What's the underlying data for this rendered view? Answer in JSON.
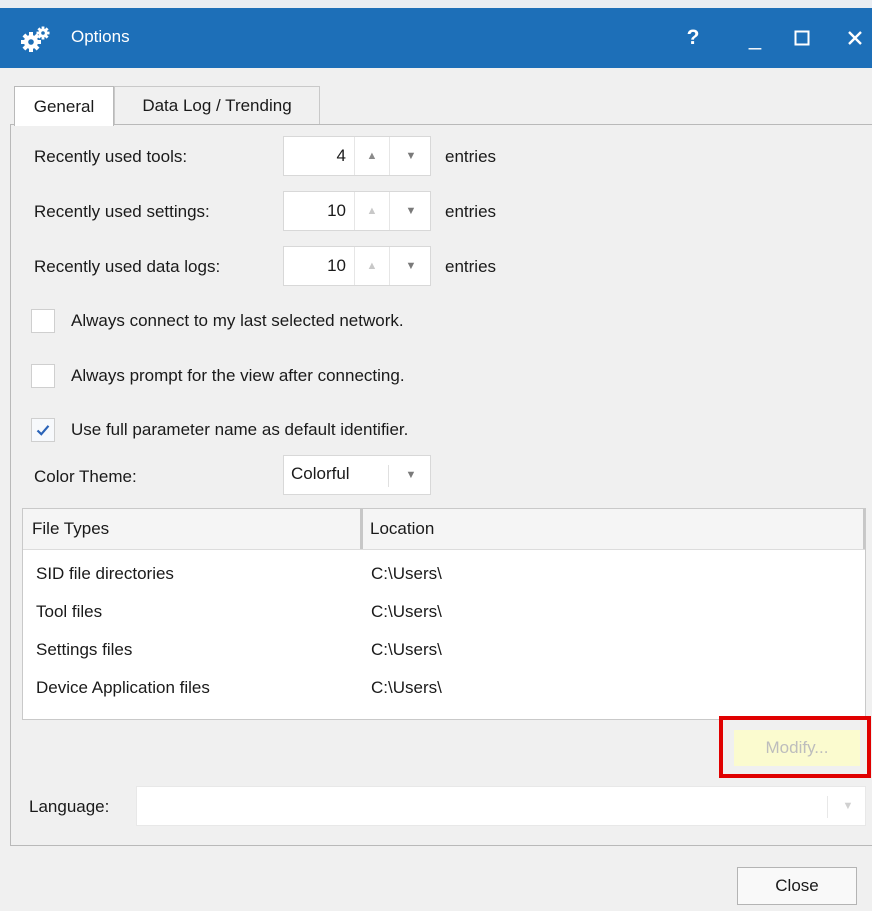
{
  "window": {
    "title": "Options",
    "help_label": "?",
    "minimize_label": "_",
    "maximize_label": "□",
    "close_label": "✕"
  },
  "tabs": [
    {
      "label": "General",
      "selected": true
    },
    {
      "label": "Data Log / Trending",
      "selected": false
    }
  ],
  "general": {
    "recent_tools": {
      "label": "Recently used tools:",
      "value": "4",
      "unit": "entries"
    },
    "recent_settings": {
      "label": "Recently used settings:",
      "value": "10",
      "unit": "entries"
    },
    "recent_data_logs": {
      "label": "Recently used data logs:",
      "value": "10",
      "unit": "entries"
    },
    "checkboxes": [
      {
        "label": "Always connect to my last selected network.",
        "checked": false
      },
      {
        "label": "Always prompt for the view after connecting.",
        "checked": false
      },
      {
        "label": "Use full parameter name as default identifier.",
        "checked": true
      }
    ],
    "color_theme": {
      "label": "Color Theme:",
      "value": "Colorful"
    }
  },
  "file_types": {
    "columns": [
      "File Types",
      "Location"
    ],
    "rows": [
      {
        "type": "SID file directories",
        "location": "C:\\Users\\"
      },
      {
        "type": "Tool files",
        "location": "C:\\Users\\"
      },
      {
        "type": "Settings files",
        "location": "C:\\Users\\"
      },
      {
        "type": "Device Application files",
        "location": "C:\\Users\\"
      }
    ]
  },
  "modify_label": "Modify...",
  "language": {
    "label": "Language:",
    "value": ""
  },
  "close_button_label": "Close",
  "icons": {
    "title": "gears-icon",
    "spin_up": "triangle-up-icon",
    "spin_down": "triangle-down-icon",
    "dropdown": "triangle-down-icon",
    "check": "checkmark-icon"
  },
  "colors": {
    "titlebar": "#1d6fb8",
    "highlight_border": "#e00000",
    "modify_bg": "#fbfbcf",
    "check": "#2a63b8"
  }
}
